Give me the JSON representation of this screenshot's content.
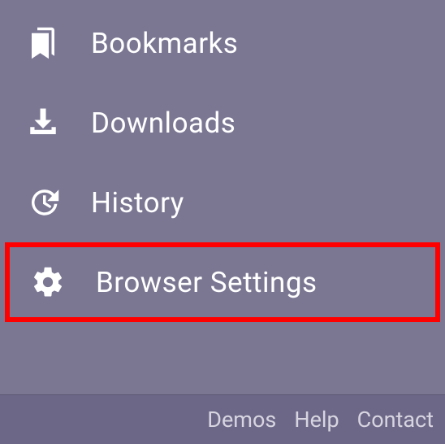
{
  "menu": {
    "items": [
      {
        "label": "Bookmarks",
        "icon": "bookmarks"
      },
      {
        "label": "Downloads",
        "icon": "download"
      },
      {
        "label": "History",
        "icon": "history"
      },
      {
        "label": "Browser Settings",
        "icon": "gear",
        "highlighted": true
      }
    ]
  },
  "footer": {
    "links": [
      {
        "label": "Demos"
      },
      {
        "label": "Help"
      },
      {
        "label": "Contact"
      }
    ]
  }
}
